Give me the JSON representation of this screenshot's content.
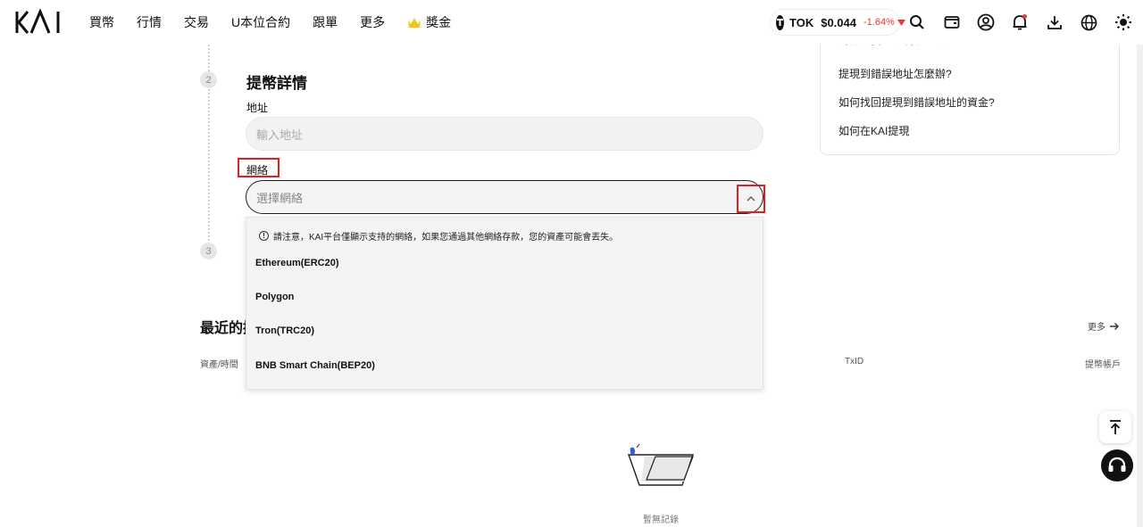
{
  "header": {
    "logo_text": "KAI",
    "nav": [
      {
        "label": "買幣"
      },
      {
        "label": "行情"
      },
      {
        "label": "交易"
      },
      {
        "label": "U本位合約"
      },
      {
        "label": "跟單"
      },
      {
        "label": "更多"
      },
      {
        "label": "獎金"
      }
    ],
    "ticker": {
      "symbol": "TOK",
      "price": "$0.044",
      "change": "-1.64%"
    },
    "icons": [
      "search-icon",
      "wallet-icon",
      "account-icon",
      "notification-icon",
      "download-icon",
      "globe-icon",
      "theme-sun-icon"
    ]
  },
  "steps": {
    "two": "2",
    "three": "3"
  },
  "details": {
    "title": "提幣詳情",
    "address_label": "地址",
    "address_placeholder": "輸入地址",
    "network_label": "網絡",
    "network_placeholder": "選擇網絡"
  },
  "dropdown": {
    "notice": "請注意，KAI平台僅顯示支持的網絡，如果您通過其他網絡存款，您的資產可能會丟失。",
    "options": [
      {
        "label": "Ethereum(ERC20)"
      },
      {
        "label": "Polygon"
      },
      {
        "label": "Tron(TRC20)"
      },
      {
        "label": "BNB Smart Chain(BEP20)"
      }
    ]
  },
  "recent": {
    "title": "最近的提",
    "more": "更多",
    "columns": {
      "asset_time": "資產/時間",
      "txid": "TxID",
      "account": "提幣帳戶"
    },
    "empty": "暫無記錄"
  },
  "faq": {
    "items": [
      {
        "label": "為什麼我的提現未到賬"
      },
      {
        "label": "提現到錯誤地址怎麼辦?"
      },
      {
        "label": "如何找回提現到錯誤地址的資金?"
      },
      {
        "label": "如何在KAI提現"
      }
    ]
  },
  "colors": {
    "accent_red": "#e02020",
    "down": "#e53935"
  }
}
